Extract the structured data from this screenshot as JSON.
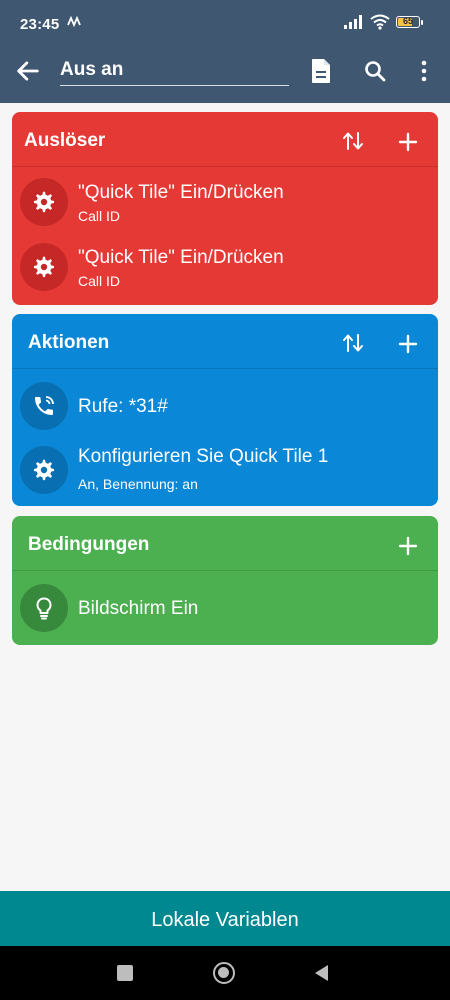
{
  "status_bar": {
    "time": "23:45",
    "battery": "65"
  },
  "app_bar": {
    "title": "Aus an"
  },
  "triggers": {
    "title": "Auslöser",
    "items": [
      {
        "label": "\"Quick Tile\" Ein/Drücken",
        "sub": "Call ID",
        "icon": "gear-icon"
      },
      {
        "label": "\"Quick Tile\" Ein/Drücken",
        "sub": "Call ID",
        "icon": "gear-icon"
      }
    ]
  },
  "actions": {
    "title": "Aktionen",
    "items": [
      {
        "label": "Rufe: *31#",
        "icon": "phone-icon"
      },
      {
        "label": "Konfigurieren Sie Quick Tile 1",
        "sub": "An, Benennung: an",
        "icon": "gear-icon"
      }
    ]
  },
  "conditions": {
    "title": "Bedingungen",
    "items": [
      {
        "label": "Bildschirm Ein",
        "icon": "lightbulb-icon"
      }
    ]
  },
  "bottom": {
    "local_variables": "Lokale Variablen"
  },
  "colors": {
    "header": "#3f5770",
    "triggers": "#e53935",
    "actions": "#0a87d6",
    "conditions": "#4caf50",
    "bottom_button": "#008891"
  }
}
